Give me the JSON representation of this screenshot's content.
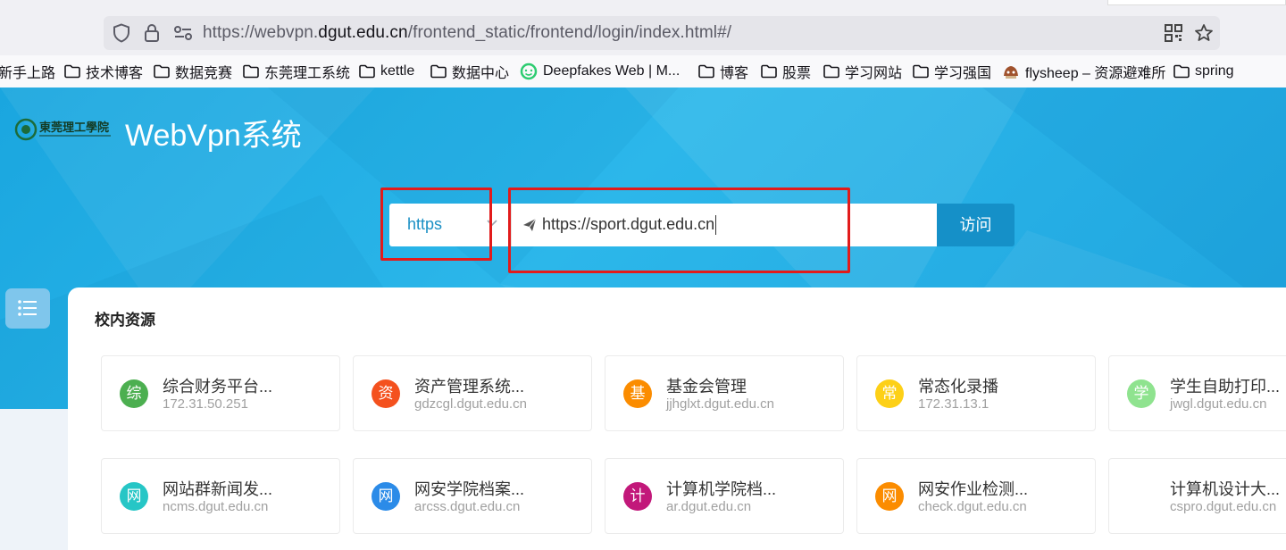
{
  "browser": {
    "url_prefix": "https://webvpn.",
    "url_domain": "dgut.edu.cn",
    "url_suffix": "/frontend_static/frontend/login/index.html#/",
    "bookmarks": [
      {
        "label": "新手上路",
        "icon": "folder-icon"
      },
      {
        "label": "技术博客",
        "icon": "folder-icon"
      },
      {
        "label": "数据竞赛",
        "icon": "folder-icon"
      },
      {
        "label": "东莞理工系统",
        "icon": "folder-icon"
      },
      {
        "label": "kettle",
        "icon": "folder-icon"
      },
      {
        "label": "数据中心",
        "icon": "folder-icon"
      },
      {
        "label": "Deepfakes Web | M...",
        "icon": "deepfakes-favicon"
      },
      {
        "label": "博客",
        "icon": "folder-icon"
      },
      {
        "label": "股票",
        "icon": "folder-icon"
      },
      {
        "label": "学习网站",
        "icon": "folder-icon"
      },
      {
        "label": "学习强国",
        "icon": "folder-icon"
      },
      {
        "label": "flysheep – 资源避难所",
        "icon": "flysheep-favicon"
      },
      {
        "label": "spring",
        "icon": "folder-icon"
      }
    ]
  },
  "header": {
    "brand": "WebVpn系统",
    "logo_text": "東莞理工學院"
  },
  "search": {
    "scheme": "https",
    "url_value": "https://sport.dgut.edu.cn",
    "visit_label": "访问"
  },
  "section": {
    "title": "校内资源"
  },
  "resources": [
    {
      "icon": "综",
      "name": "综合财务平台...",
      "domain": "172.31.50.251",
      "color": "#4caf50"
    },
    {
      "icon": "资",
      "name": "资产管理系统...",
      "domain": "gdzcgl.dgut.edu.cn",
      "color": "#f4511e"
    },
    {
      "icon": "基",
      "name": "基金会管理",
      "domain": "jjhglxt.dgut.edu.cn",
      "color": "#fb8c00"
    },
    {
      "icon": "常",
      "name": "常态化录播",
      "domain": "172.31.13.1",
      "color": "#fdd017"
    },
    {
      "icon": "学",
      "name": "学生自助打印...",
      "domain": "jwgl.dgut.edu.cn",
      "color": "#8fe38f"
    },
    {
      "icon": "网",
      "name": "网站群新闻发...",
      "domain": "ncms.dgut.edu.cn",
      "color": "#26c6c6"
    },
    {
      "icon": "网",
      "name": "网安学院档案...",
      "domain": "arcss.dgut.edu.cn",
      "color": "#2b8be8"
    },
    {
      "icon": "计",
      "name": "计算机学院档...",
      "domain": "ar.dgut.edu.cn",
      "color": "#c2187a"
    },
    {
      "icon": "网",
      "name": "网安作业检测...",
      "domain": "check.dgut.edu.cn",
      "color": "#fb8c00"
    },
    {
      "icon": "",
      "name": "计算机设计大...",
      "domain": "cspro.dgut.edu.cn",
      "color": "#ffffff"
    }
  ]
}
